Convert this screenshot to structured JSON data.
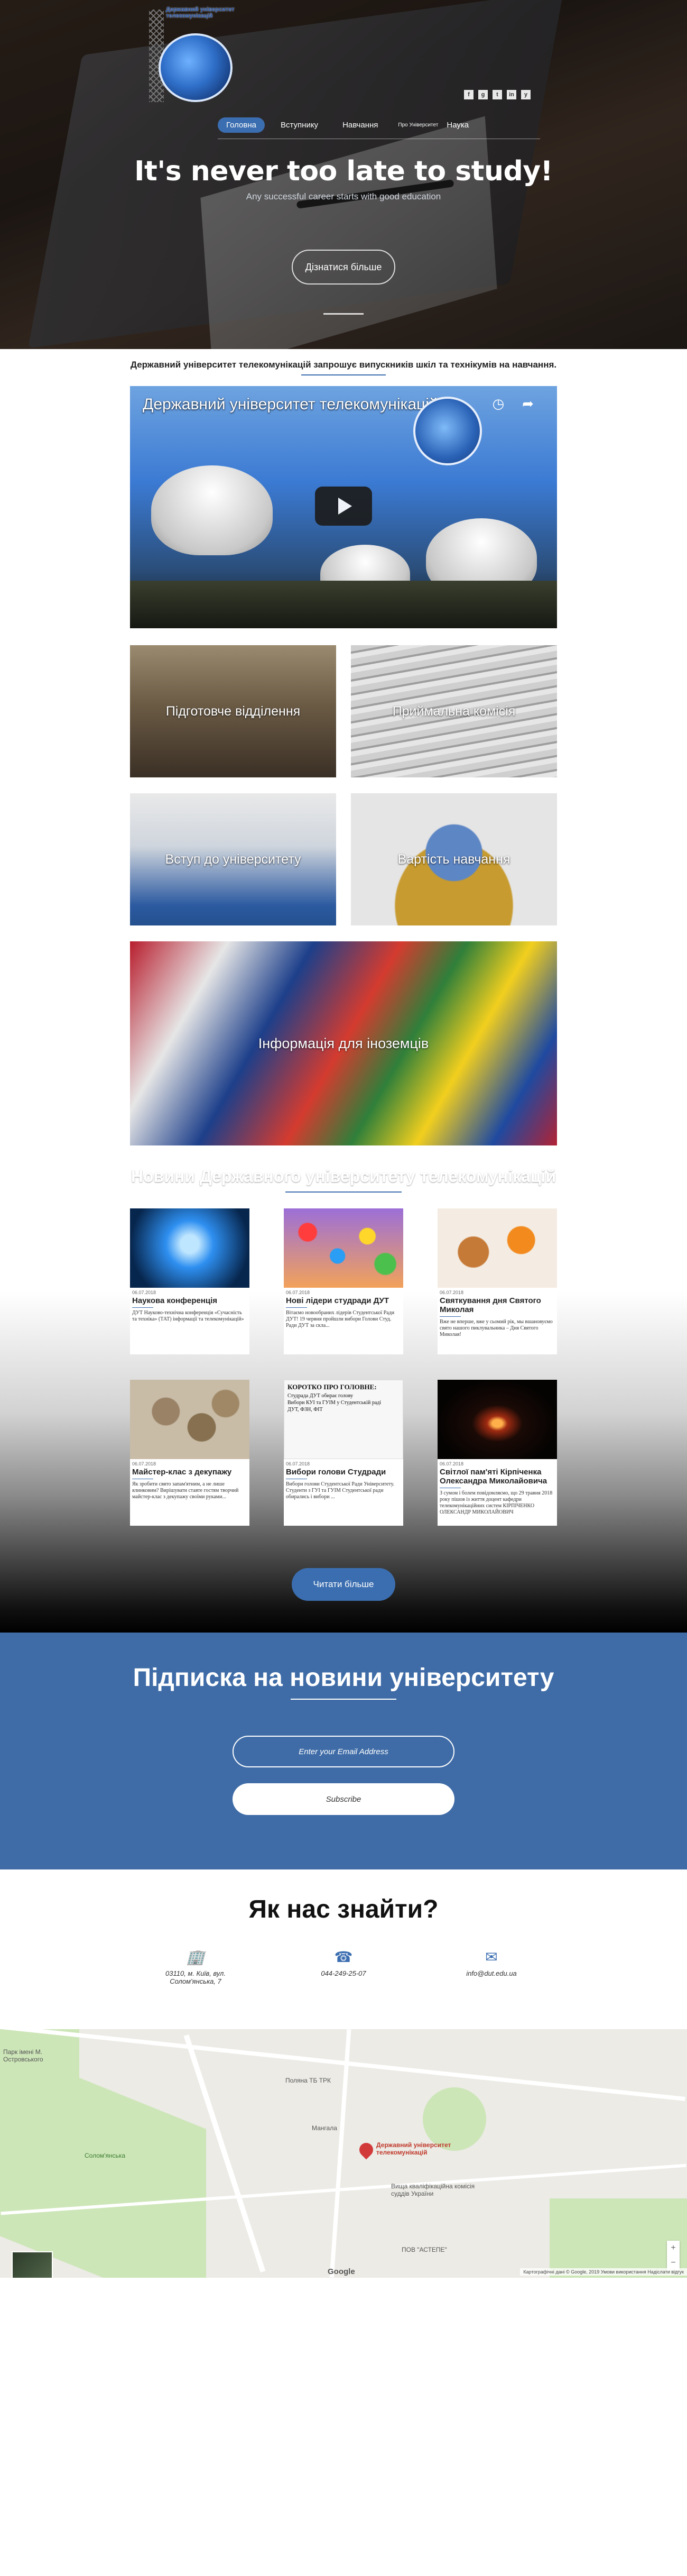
{
  "header": {
    "logo_title": "Державний університет телекомунікацій",
    "socials": [
      "f",
      "g",
      "t",
      "in",
      "y"
    ],
    "nav": [
      {
        "label": "Головна",
        "active": true
      },
      {
        "label": "Вступнику",
        "active": false
      },
      {
        "label": "Навчання",
        "active": false
      },
      {
        "label": "Про Університет",
        "active": false
      },
      {
        "label": "Наука",
        "active": false
      }
    ],
    "headline": "It's never too late to study!",
    "subheadline": "Any successful career starts with good education",
    "donate_label": "Дізнатися більше"
  },
  "invite_text": "Державний університет телекомунікацій запрошує випускників шкіл та технікумів на навчання.",
  "video": {
    "title": "Державний університет телекомунікацій"
  },
  "tiles": [
    {
      "label": "Підготовче відділення"
    },
    {
      "label": "Приймальна комісія"
    },
    {
      "label": "Вступ до університету"
    },
    {
      "label": "Вартість навчання"
    },
    {
      "label": "Інформація для іноземців"
    }
  ],
  "news": {
    "title": "Новини Державного університету телекомунікацій",
    "items": [
      {
        "date": "06.07.2018",
        "title": "Наукова конференція",
        "text": "ДУТ Науково-технічна конференція «Сучасність та техніка» (ТАТ) інформації та телекомунікацій»"
      },
      {
        "date": "06.07.2018",
        "title": "Нові лідери студради ДУТ",
        "text": "Вітаємо новообраних лідерів Студентської Ради ДУТ! 19 червня пройшли вибори Голови Студ. Ради ДУТ за скла..."
      },
      {
        "date": "06.07.2018",
        "title": "Святкування дня Святого Миколая",
        "text": "Вже не вперше, вже у сьомий рік, мы вшановуємо свято нашого пиклувальника – Дня Святого Миколая!"
      },
      {
        "date": "06.07.2018",
        "title": "Майстер-клас з декупажу",
        "text": "Як зробити свято запам'ятним, а не лише ялинковим? Вирішувати ставте гостям творчий майстер-клас з декупажу своїми руками..."
      },
      {
        "date": "06.07.2018",
        "title": "Вибори голови Студради",
        "text": "Вибори голови Студентської Ради Університету. Студенти з ГУІ та ГУІМ Студентської ради обирались і вибори ..."
      },
      {
        "date": "06.07.2018",
        "title": "Світлої пам'яті Кірпіченка Олександра Миколайовича",
        "text": "З сумом і болем повідомляємо, що 29 травня 2018 року пішов із життя доцент кафедри телекомунікаційних систем КІРПІЧЕНКО ОЛЕКСАНДР МИКОЛАЙОВИЧ"
      }
    ],
    "newspaper_headline": "КОРОТКО ПРО ГОЛОВНЕ:",
    "newspaper_lines": [
      "Студрада ДУТ обирає голову",
      "Вибори КУІ та ГУІМ у Студентській раді",
      "ДУТ, ФЗН, ФІТ"
    ],
    "more_label": "Читати більше"
  },
  "subscribe": {
    "title": "Підписка на новини університету",
    "email_placeholder": "Enter your Email Address",
    "button_label": "Subscribe"
  },
  "contacts": {
    "title": "Як нас знайти?",
    "address": "03110, м. Київ, вул. Солом'янська, 7",
    "phone": "044-249-25-07",
    "email": "info@dut.edu.ua"
  },
  "map": {
    "labels": [
      "Парк імені М. Островського",
      "Поляна ТБ ТРК",
      "Мангала",
      "Солом'янська",
      "Вища кваліфікаційна комісія суддів України",
      "ПОВ \"АСТЕПЕ\""
    ],
    "place_name": "Державний університет телекомунікацій",
    "google": "Google",
    "attribution": "Картографічні дані © Google, 2019   Умови використання   Надіслати відгук"
  }
}
